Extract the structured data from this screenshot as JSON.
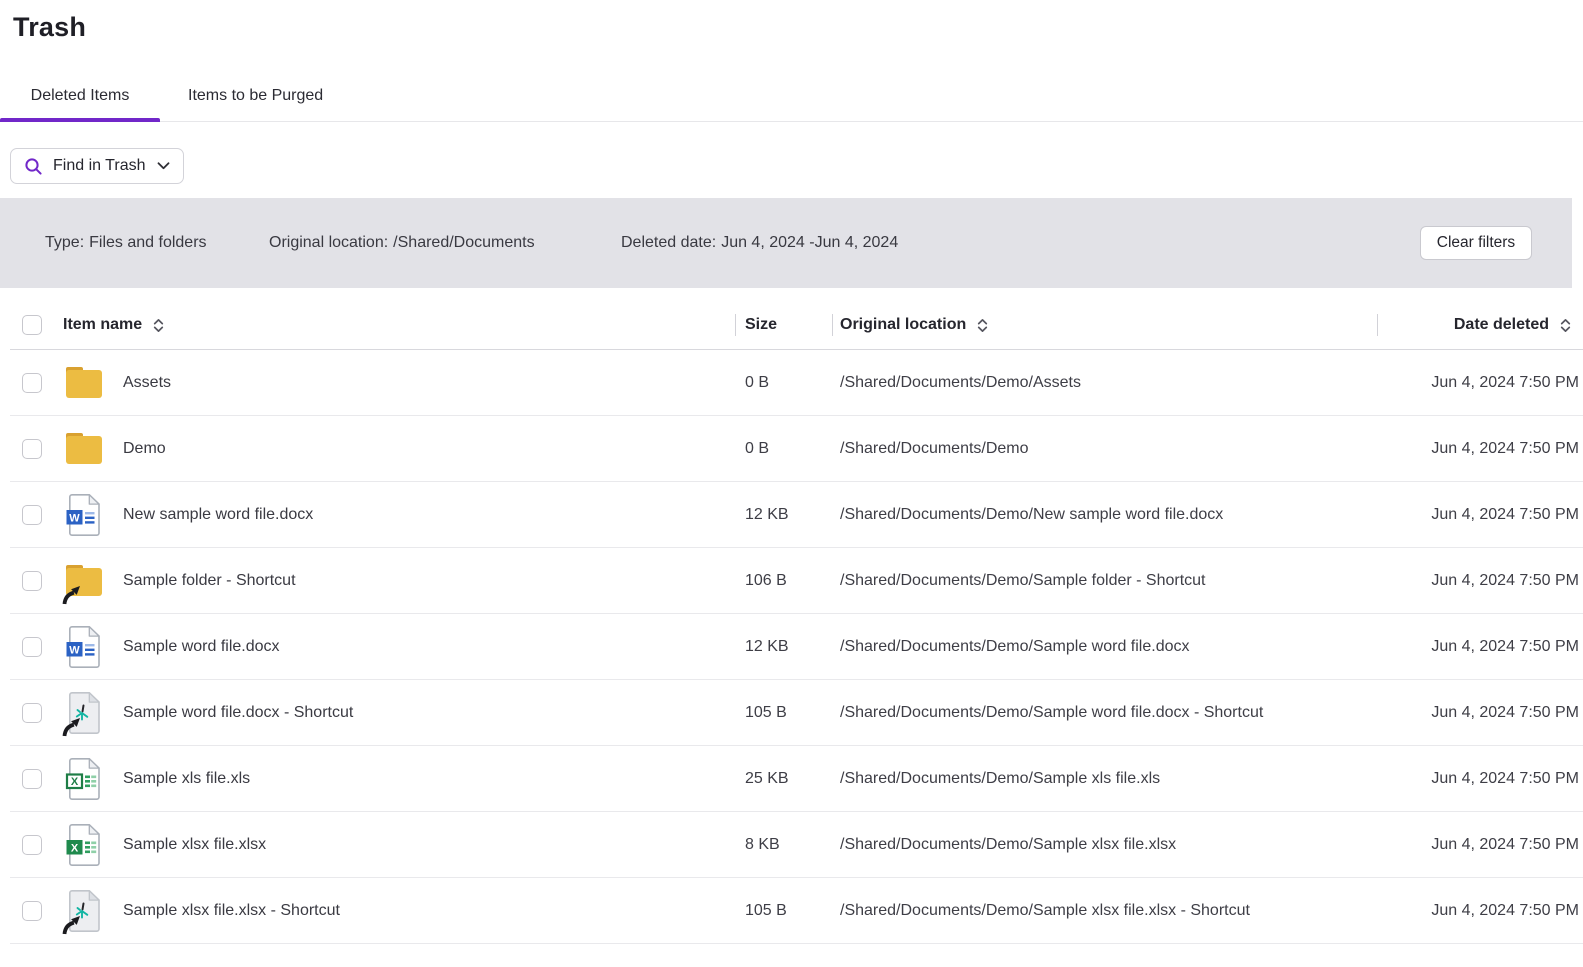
{
  "page": {
    "title": "Trash"
  },
  "tabs": [
    {
      "label": "Deleted Items",
      "active": true
    },
    {
      "label": "Items to be Purged",
      "active": false
    }
  ],
  "search": {
    "label": "Find in Trash"
  },
  "filter_bar": {
    "filters": [
      {
        "label": "Type:",
        "value": "Files and folders"
      },
      {
        "label": "Original location:",
        "value": "/Shared/Documents"
      },
      {
        "label": "Deleted date:",
        "value": "Jun 4, 2024 -Jun 4, 2024"
      }
    ],
    "clear_label": "Clear filters"
  },
  "table": {
    "columns": {
      "name": "Item name",
      "size": "Size",
      "location": "Original location",
      "date": "Date deleted"
    },
    "rows": [
      {
        "icon": "folder",
        "name": "Assets",
        "size": "0 B",
        "location": "/Shared/Documents/Demo/Assets",
        "date": "Jun 4, 2024 7:50 PM"
      },
      {
        "icon": "folder",
        "name": "Demo",
        "size": "0 B",
        "location": "/Shared/Documents/Demo",
        "date": "Jun 4, 2024 7:50 PM"
      },
      {
        "icon": "word-file",
        "name": "New sample word file.docx",
        "size": "12 KB",
        "location": "/Shared/Documents/Demo/New sample word file.docx",
        "date": "Jun 4, 2024 7:50 PM"
      },
      {
        "icon": "folder-shortcut",
        "name": "Sample folder - Shortcut",
        "size": "106 B",
        "location": "/Shared/Documents/Demo/Sample folder - Shortcut",
        "date": "Jun 4, 2024 7:50 PM"
      },
      {
        "icon": "word-file",
        "name": "Sample word file.docx",
        "size": "12 KB",
        "location": "/Shared/Documents/Demo/Sample word file.docx",
        "date": "Jun 4, 2024 7:50 PM"
      },
      {
        "icon": "file-shortcut",
        "name": "Sample word file.docx - Shortcut",
        "size": "105 B",
        "location": "/Shared/Documents/Demo/Sample word file.docx - Shortcut",
        "date": "Jun 4, 2024 7:50 PM"
      },
      {
        "icon": "excel-xls-file",
        "name": "Sample xls file.xls",
        "size": "25 KB",
        "location": "/Shared/Documents/Demo/Sample xls file.xls",
        "date": "Jun 4, 2024 7:50 PM"
      },
      {
        "icon": "excel-xlsx-file",
        "name": "Sample xlsx file.xlsx",
        "size": "8 KB",
        "location": "/Shared/Documents/Demo/Sample xlsx file.xlsx",
        "date": "Jun 4, 2024 7:50 PM"
      },
      {
        "icon": "file-shortcut",
        "name": "Sample xlsx file.xlsx - Shortcut",
        "size": "105 B",
        "location": "/Shared/Documents/Demo/Sample xlsx file.xlsx - Shortcut",
        "date": "Jun 4, 2024 7:50 PM"
      }
    ]
  },
  "colors": {
    "accent_purple": "#7127c9",
    "filter_bar_bg": "#e2e2e7",
    "folder_yellow": "#ecbc42",
    "word_blue": "#2b62c4",
    "excel_green": "#1f8a4d",
    "shortcut_teal": "#12b5a3"
  }
}
